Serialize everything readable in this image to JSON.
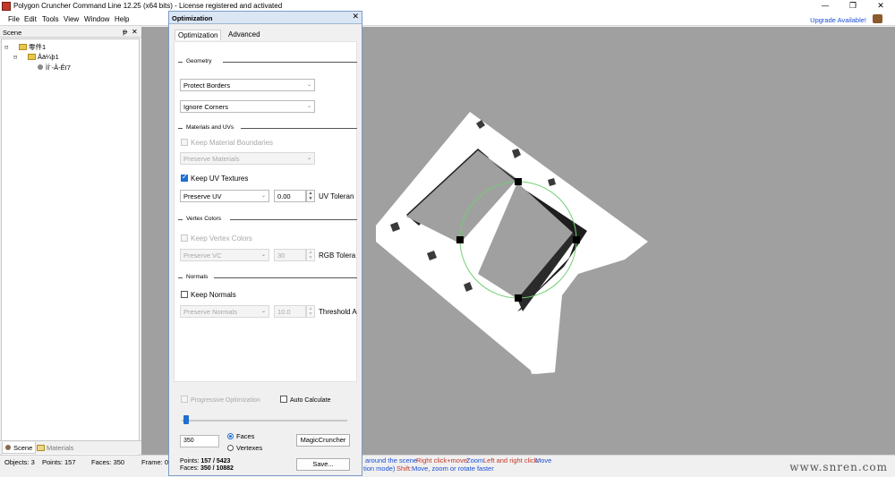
{
  "window": {
    "title": "Polygon Cruncher Command Line 12.25 (x64 bits) - License registered and activated",
    "controls": [
      "—",
      "❐",
      "✕"
    ]
  },
  "menu": {
    "items": [
      "File",
      "Edit",
      "Tools",
      "View",
      "Window",
      "Help"
    ],
    "upgrade": "Upgrade Available!"
  },
  "scene": {
    "title": "Scene",
    "pin": "ᵽ",
    "close": "✕",
    "tree": [
      {
        "expander": "⊟",
        "label": "零件1",
        "kind": "folder"
      },
      {
        "expander": "⊟",
        "label": "Åä¼þ1",
        "kind": "folder"
      },
      {
        "expander": "",
        "label": "ÌÍ¨-Â-Êï7",
        "kind": "object"
      }
    ],
    "tabs": [
      "Scene",
      "Materials"
    ]
  },
  "status": {
    "objects": "Objects: 3",
    "points": "Points: 157",
    "faces": "Faces: 350",
    "frame": "Frame: 0/",
    "hint1_a": "around the scene",
    "hint1_b": "Right click+move:",
    "hint1_c": "Zoom",
    "hint1_d": "Left and right click:",
    "hint1_e": "Move",
    "hint2_a": "tion mode)",
    "hint2_b": "Shift:",
    "hint2_c": "Move, zoom or rotate faster"
  },
  "dialog": {
    "title": "Optimization",
    "close": "✕",
    "tabs": [
      "Optimization",
      "Advanced"
    ],
    "geometry": {
      "header": "Geometry",
      "borders": "Protect Borders",
      "corners": "Ignore Corners"
    },
    "materials": {
      "header": "Materials and UVs",
      "keep_boundaries": "Keep Material Boundaries",
      "preserve_materials": "Preserve Materials",
      "keep_uv": "Keep UV Textures",
      "preserve_uv": "Preserve UV",
      "uv_value": "0.00",
      "uv_label": "UV Toleran"
    },
    "vertex": {
      "header": "Vertex Colors",
      "keep": "Keep Vertex Colors",
      "preserve": "Preserve VC",
      "value": "30",
      "label": "RGB Tolera"
    },
    "normals": {
      "header": "Normals",
      "keep": "Keep Normals",
      "preserve": "Preserve Normals",
      "value": "10.0",
      "label": "Threshold A"
    },
    "progressive": "Progressive Optimization",
    "auto_calc": "Auto Calculate",
    "slider_fraction": 0.03,
    "count_value": "350",
    "mode_faces": "Faces",
    "mode_vertexes": "Vertexes",
    "magic": "MagicCruncher",
    "points_label": "Points:",
    "points_value": "157 / 5423",
    "faces_label": "Faces:",
    "faces_value": "350 / 10882",
    "save": "Save..."
  },
  "watermark": "www.snren.com",
  "colors": {
    "viewport": "#a0a0a0",
    "accent": "#1f6fd1",
    "link": "#1a4fd6"
  }
}
